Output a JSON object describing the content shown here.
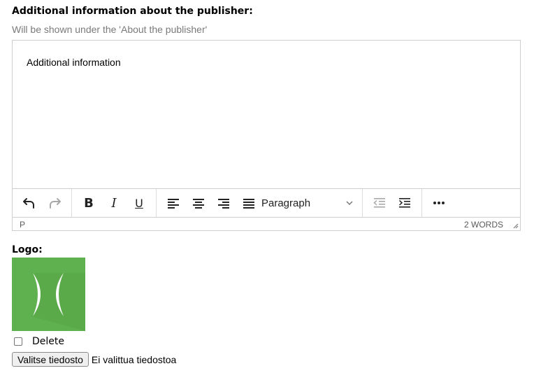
{
  "additional_info": {
    "label": "Additional information about the publisher:",
    "help": "Will be shown under the 'About the publisher'",
    "editor_content": "Additional information",
    "toolbar": {
      "bold": "B",
      "italic": "I",
      "underline": "U",
      "block_format": "Paragraph"
    },
    "status": {
      "path": "P",
      "word_count": "2 WORDS"
    }
  },
  "logo": {
    "label": "Logo:",
    "brand_color": "#5fb14f",
    "delete_label": "Delete",
    "delete_checked": false,
    "choose_file_label": "Valitse tiedosto",
    "no_file_text": "Ei valittua tiedostoa"
  },
  "icons": [
    "undo-icon",
    "redo-icon",
    "align-left-icon",
    "align-center-icon",
    "align-right-icon",
    "align-justify-icon",
    "chevron-down-icon",
    "outdent-icon",
    "indent-icon",
    "more-icon",
    "resize-handle-icon"
  ]
}
